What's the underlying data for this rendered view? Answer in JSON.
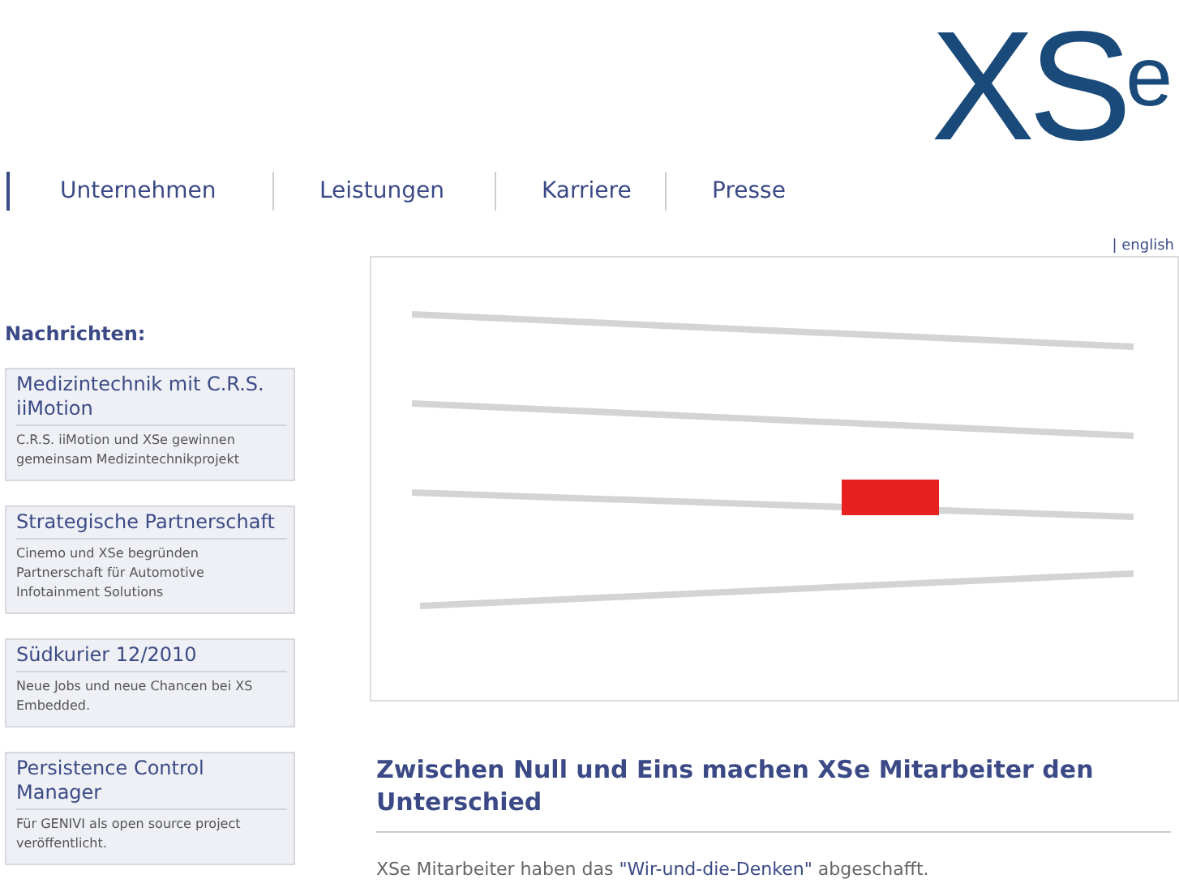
{
  "logo": "XS$^{e}$",
  "nav": [
    {
      "label": "Unternehmen"
    },
    {
      "label": "Leistungen"
    },
    {
      "label": "Karriere"
    },
    {
      "label": "Presse"
    }
  ],
  "language_link": "| english",
  "news": {
    "title": "Nachrichten:",
    "items": [
      {
        "title": "Medizintechnik mit C.R.S. iiMotion",
        "text": "C.R.S. iiMotion und XSe gewinnen gemeinsam Medizintechnikprojekt"
      },
      {
        "title": "Strategische Partnerschaft",
        "text": "Cinemo und XSe begründen Partnerschaft für Automotive Infotainment Solutions"
      },
      {
        "title": "Südkurier 12/2010",
        "text": "Neue Jobs und neue Chancen bei XS Embedded."
      },
      {
        "title": "Persistence Control Manager",
        "text": "Für GENIVI als open source project veröffentlicht."
      }
    ]
  },
  "article": {
    "heading": "Zwischen Null und Eins machen XSe Mitarbeiter den Unterschied",
    "text_before": "XSe Mitarbeiter haben das ",
    "link": "\"Wir-und-die-Denken\"",
    "text_after": " abgeschafft."
  }
}
